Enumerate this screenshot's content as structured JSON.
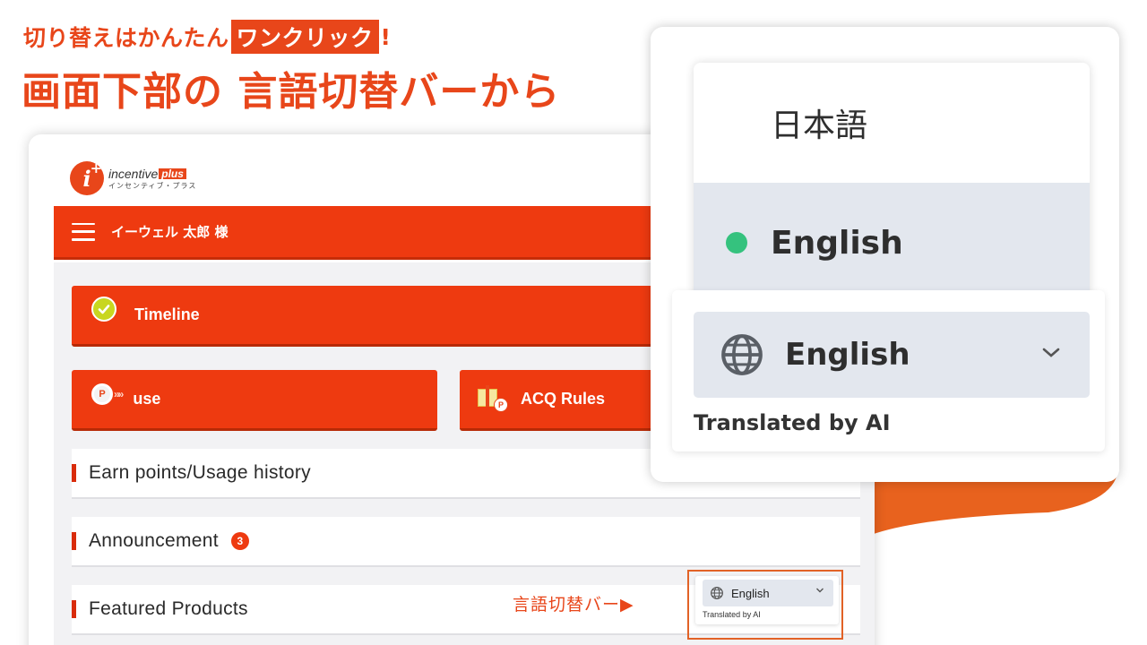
{
  "headline": {
    "sub_pre": "切り替えはかんたん",
    "sub_highlight": "ワンクリック",
    "sub_post": "!",
    "main": "画面下部の 言語切替バーから"
  },
  "colors": {
    "accent": "#e8461a",
    "header_red": "#ee3a10",
    "active_dot": "#35c27e",
    "select_bg": "#e3e7ee"
  },
  "app": {
    "logo": {
      "brand": "incentive",
      "brand_plus": "plus",
      "kana": "インセンティブ・プラス",
      "mark": "i",
      "mark_plus": "+"
    },
    "header": {
      "user_name": "イーウェル 太郎 様",
      "menu_icon": "hamburger-menu-icon"
    },
    "buttons": {
      "timeline": "Timeline",
      "use": "use",
      "acq_rules": "ACQ Rules",
      "coin_letter": "P",
      "coin_trail": "»»",
      "gift_letter": "P"
    },
    "sections": {
      "earn": "Earn points/Usage history",
      "announcement": "Announcement",
      "announcement_count": "3",
      "featured": "Featured Products"
    }
  },
  "callout": {
    "label": "言語切替バー▶"
  },
  "mini_switcher": {
    "selected": "English",
    "note": "Translated by AI"
  },
  "zoom": {
    "options": [
      {
        "label": "日本語",
        "active": false
      },
      {
        "label": "English",
        "active": true
      }
    ],
    "selected": "English",
    "note": "Translated by AI"
  }
}
